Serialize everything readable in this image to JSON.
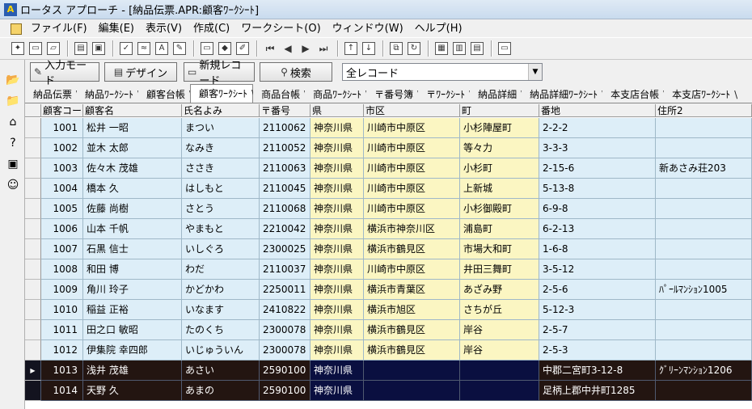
{
  "window": {
    "title": "ロータス アプローチ - [納品伝票.APR:顧客ﾜｰｸｼｰﾄ]",
    "app_icon": "app-logo-icon"
  },
  "menu": [
    "ファイル(F)",
    "編集(E)",
    "表示(V)",
    "作成(C)",
    "ワークシート(O)",
    "ウィンドウ(W)",
    "ヘルプ(H)"
  ],
  "modebar": {
    "input_mode": "入力モード",
    "design": "デザイン",
    "new_record": "新規レコード",
    "search": "検索",
    "record_filter": "全レコード"
  },
  "tabs": [
    "納品伝票",
    "納品ﾜｰｸｼｰﾄ",
    "顧客台帳",
    "顧客ﾜｰｸｼｰﾄ",
    "商品台帳",
    "商品ﾜｰｸｼｰﾄ",
    "〒番号簿",
    "〒ﾜｰｸｼｰﾄ",
    "納品詳細",
    "納品詳細ﾜｰｸｼｰﾄ",
    "本支店台帳",
    "本支店ﾜｰｸｼｰﾄ"
  ],
  "active_tab": 3,
  "columns": [
    "顧客コード",
    "顧客名",
    "氏名よみ",
    "〒番号",
    "県",
    "市区",
    "町",
    "番地",
    "住所2"
  ],
  "rows": [
    [
      "1001",
      "松井 一昭",
      "まつい",
      "2110062",
      "神奈川県",
      "川崎市中原区",
      "小杉陣屋町",
      "2-2-2",
      ""
    ],
    [
      "1002",
      "並木 太郎",
      "なみき",
      "2110052",
      "神奈川県",
      "川崎市中原区",
      "等々力",
      "3-3-3",
      ""
    ],
    [
      "1003",
      "佐々木 茂雄",
      "ささき",
      "2110063",
      "神奈川県",
      "川崎市中原区",
      "小杉町",
      "2-15-6",
      "新あさみ荘203"
    ],
    [
      "1004",
      "橋本 久",
      "はしもと",
      "2110045",
      "神奈川県",
      "川崎市中原区",
      "上新城",
      "5-13-8",
      ""
    ],
    [
      "1005",
      "佐藤 尚樹",
      "さとう",
      "2110068",
      "神奈川県",
      "川崎市中原区",
      "小杉御殿町",
      "6-9-8",
      ""
    ],
    [
      "1006",
      "山本 千帆",
      "やまもと",
      "2210042",
      "神奈川県",
      "横浜市神奈川区",
      "浦島町",
      "6-2-13",
      ""
    ],
    [
      "1007",
      "石黒 信士",
      "いしぐろ",
      "2300025",
      "神奈川県",
      "横浜市鶴見区",
      "市場大和町",
      "1-6-8",
      ""
    ],
    [
      "1008",
      "和田 博",
      "わだ",
      "2110037",
      "神奈川県",
      "川崎市中原区",
      "井田三舞町",
      "3-5-12",
      ""
    ],
    [
      "1009",
      "角川 玲子",
      "かどかわ",
      "2250011",
      "神奈川県",
      "横浜市青葉区",
      "あざみ野",
      "2-5-6",
      "ﾊﾟｰﾙﾏﾝｼｮﾝ1005"
    ],
    [
      "1010",
      "稲益 正裕",
      "いなます",
      "2410822",
      "神奈川県",
      "横浜市旭区",
      "さちが丘",
      "5-12-3",
      ""
    ],
    [
      "1011",
      "田之口 敏昭",
      "たのくち",
      "2300078",
      "神奈川県",
      "横浜市鶴見区",
      "岸谷",
      "2-5-7",
      ""
    ],
    [
      "1012",
      "伊集院 幸四郎",
      "いじゅういん",
      "2300078",
      "神奈川県",
      "横浜市鶴見区",
      "岸谷",
      "2-5-3",
      ""
    ],
    [
      "1013",
      "浅井 茂雄",
      "あさい",
      "2590100",
      "神奈川県",
      "",
      "",
      "中郡二宮町3-12-8",
      "ｸﾞﾘｰﾝﾏﾝｼｮﾝ1206"
    ],
    [
      "1014",
      "天野 久",
      "あまの",
      "2590100",
      "神奈川県",
      "",
      "",
      "足柄上郡中井町1285",
      ""
    ]
  ],
  "selected_rows": [
    12,
    13
  ],
  "current_row": 12,
  "colors": {
    "light": "#ddeef8",
    "yellow": "#fbf6c2",
    "selected_light": "#231511",
    "selected_yellow": "#0a0f40"
  }
}
